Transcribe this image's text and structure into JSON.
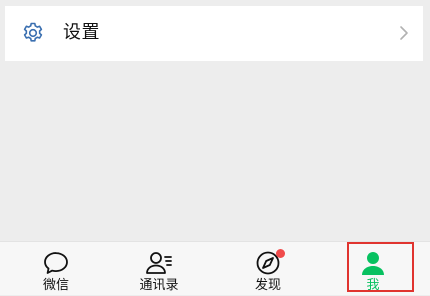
{
  "settings": {
    "label": "设置",
    "icon": "gear-icon",
    "chevron": "chevron-right-icon"
  },
  "tabbar": {
    "tabs": [
      {
        "id": "weixin",
        "label": "微信",
        "icon": "chat-bubble-icon",
        "active": false
      },
      {
        "id": "contacts",
        "label": "通讯录",
        "icon": "contacts-icon",
        "active": false
      },
      {
        "id": "discover",
        "label": "发现",
        "icon": "compass-icon",
        "active": false,
        "badge": "red-dot"
      },
      {
        "id": "me",
        "label": "我",
        "icon": "person-icon",
        "active": true
      }
    ]
  },
  "colors": {
    "accent": "#07c160",
    "settings_icon": "#3a6fb0",
    "badge": "#f04b4b",
    "highlight": "#e0342f",
    "background": "#ededed"
  }
}
